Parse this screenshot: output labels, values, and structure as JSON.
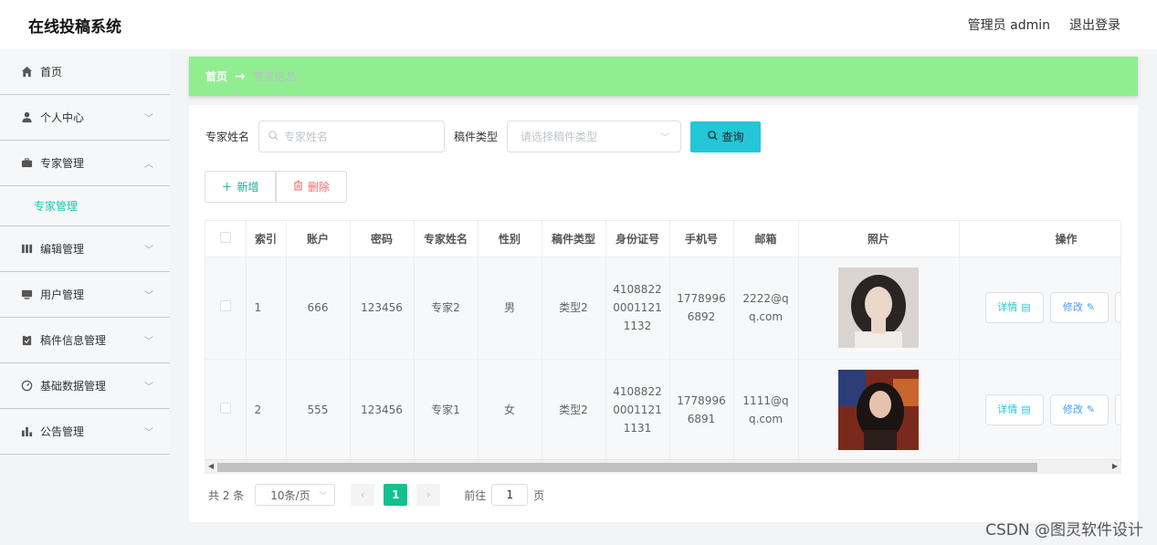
{
  "header": {
    "app_title": "在线投稿系统",
    "user_label": "管理员 admin",
    "logout_label": "退出登录"
  },
  "sidebar": {
    "items": [
      {
        "label": "首页",
        "icon": "home-icon"
      },
      {
        "label": "个人中心",
        "icon": "user-icon"
      },
      {
        "label": "专家管理",
        "icon": "briefcase-icon",
        "expanded": true
      },
      {
        "label": "编辑管理",
        "icon": "bar-icon"
      },
      {
        "label": "用户管理",
        "icon": "monitor-icon"
      },
      {
        "label": "稿件信息管理",
        "icon": "clipboard-icon"
      },
      {
        "label": "基础数据管理",
        "icon": "gauge-icon"
      },
      {
        "label": "公告管理",
        "icon": "chart-icon"
      }
    ],
    "sub_item": "专家管理"
  },
  "breadcrumb": {
    "home": "首页",
    "sep": "→",
    "current": "专家信息"
  },
  "search": {
    "name_label": "专家姓名",
    "name_placeholder": "专家姓名",
    "type_label": "稿件类型",
    "type_placeholder": "请选择稿件类型",
    "query_label": "查询"
  },
  "actions": {
    "add_label": "新增",
    "delete_label": "删除"
  },
  "table": {
    "columns": [
      "索引",
      "账户",
      "密码",
      "专家姓名",
      "性别",
      "稿件类型",
      "身份证号",
      "手机号",
      "邮箱",
      "照片",
      "操作"
    ],
    "rows": [
      {
        "index": "1",
        "account": "666",
        "password": "123456",
        "name": "专家2",
        "gender": "男",
        "type": "类型2",
        "id_card": "410882200011211132",
        "id_lines": [
          "4108822",
          "0001121",
          "1132"
        ],
        "phone_lines": [
          "1778996",
          "6892"
        ],
        "email_lines": [
          "2222@q",
          "q.com"
        ]
      },
      {
        "index": "2",
        "account": "555",
        "password": "123456",
        "name": "专家1",
        "gender": "女",
        "type": "类型2",
        "id_card": "410882200011211131",
        "id_lines": [
          "4108822",
          "0001121",
          "1131"
        ],
        "phone_lines": [
          "1778996",
          "6891"
        ],
        "email_lines": [
          "1111@q",
          "q.com"
        ]
      }
    ],
    "detail_label": "详情",
    "edit_label": "修改"
  },
  "pager": {
    "total_label": "共 2 条",
    "size_label": "10条/页",
    "current_page": "1",
    "goto_label": "前往",
    "goto_value": "1",
    "page_suffix": "页"
  },
  "watermark": "CSDN @图灵软件设计",
  "colors": {
    "breadcrumb_bg": "#90ee90",
    "query_button": "#25c6d8",
    "active_page": "#13c08f",
    "submenu_text": "#24c4b0"
  }
}
